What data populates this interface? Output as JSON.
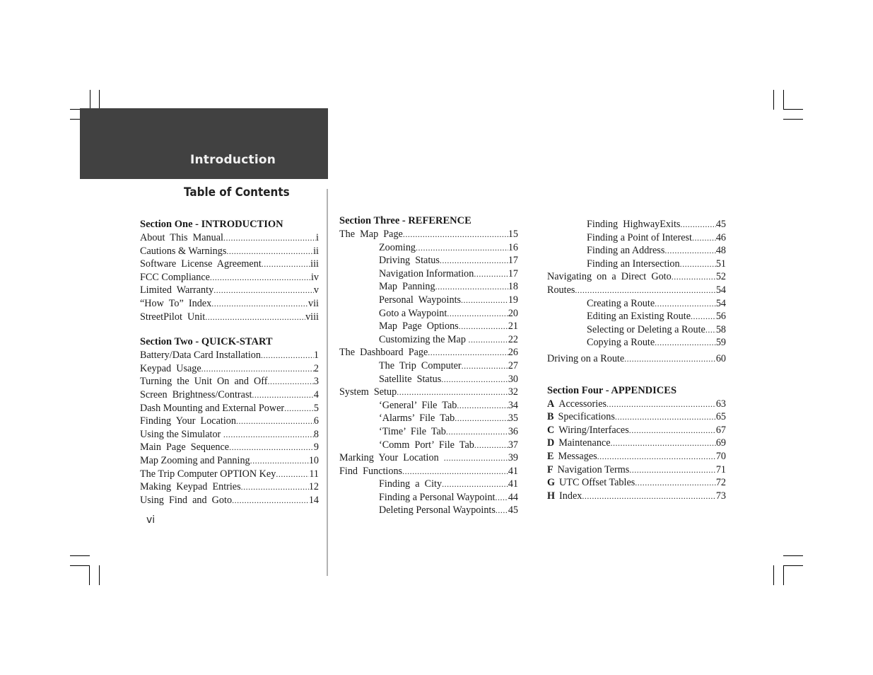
{
  "banner": {
    "title": "Introduction"
  },
  "toc_heading": "Table of Contents",
  "page_number": "vi",
  "columns": {
    "one": {
      "section_one": {
        "title": "Section One - INTRODUCTION",
        "entries": [
          {
            "label": "About  This  Manual",
            "page": "i"
          },
          {
            "label": "Cautions & Warnings",
            "page": "ii"
          },
          {
            "label": "Software  License  Agreement",
            "page": "iii"
          },
          {
            "label": "FCC Compliance",
            "page": "iv"
          },
          {
            "label": "Limited  Warranty",
            "page": "v"
          },
          {
            "label": "“How  To”  Index",
            "page": "vii"
          },
          {
            "label": "StreetPilot  Unit",
            "page": "viii"
          }
        ]
      },
      "section_two": {
        "title": "Section Two - QUICK-START",
        "entries": [
          {
            "label": "Battery/Data Card Installation",
            "page": "1"
          },
          {
            "label": "Keypad  Usage",
            "page": "2"
          },
          {
            "label": "Turning  the  Unit  On  and  Off",
            "page": "3"
          },
          {
            "label": "Screen  Brightness/Contrast",
            "page": "4"
          },
          {
            "label": "Dash Mounting and External Power",
            "page": "5"
          },
          {
            "label": "Finding  Your  Location",
            "page": "6"
          },
          {
            "label": "Using the Simulator ",
            "page": "8"
          },
          {
            "label": "Main  Page  Sequence",
            "page": "9"
          },
          {
            "label": "Map Zooming and Panning",
            "page": "10"
          },
          {
            "label": "The Trip Computer OPTION Key",
            "page": "11"
          },
          {
            "label": "Making  Keypad  Entries",
            "page": "12"
          },
          {
            "label": "Using  Find  and  Goto",
            "page": "14"
          }
        ]
      }
    },
    "two": {
      "section_three": {
        "title": "Section Three - REFERENCE",
        "entries": [
          {
            "label": "The  Map  Page",
            "page": "15",
            "indent": false
          },
          {
            "label": "Zooming",
            "page": "16",
            "indent": true
          },
          {
            "label": "Driving  Status",
            "page": "17",
            "indent": true
          },
          {
            "label": "Navigation Information",
            "page": "17",
            "indent": true
          },
          {
            "label": "Map  Panning",
            "page": "18",
            "indent": true
          },
          {
            "label": "Personal  Waypoints",
            "page": "19",
            "indent": true
          },
          {
            "label": "Goto a Waypoint",
            "page": "20",
            "indent": true
          },
          {
            "label": "Map  Page  Options",
            "page": "21",
            "indent": true
          },
          {
            "label": "Customizing the Map ",
            "page": "22",
            "indent": true
          },
          {
            "label": "The  Dashboard  Page",
            "page": "26",
            "indent": false
          },
          {
            "label": "The  Trip  Computer",
            "page": "27",
            "indent": true
          },
          {
            "label": "Satellite  Status",
            "page": "30",
            "indent": true
          },
          {
            "label": "System  Setup",
            "page": "32",
            "indent": false
          },
          {
            "label": "‘General’  File  Tab",
            "page": "34",
            "indent": true
          },
          {
            "label": "‘Alarms’  File  Tab",
            "page": "35",
            "indent": true
          },
          {
            "label": "‘Time’  File  Tab",
            "page": "36",
            "indent": true
          },
          {
            "label": "‘Comm  Port’  File  Tab",
            "page": "37",
            "indent": true
          },
          {
            "label": "Marking  Your  Location  ",
            "page": "39",
            "indent": false
          },
          {
            "label": "Find  Functions",
            "page": "41",
            "indent": false
          },
          {
            "label": "Finding  a  City",
            "page": "41",
            "indent": true
          },
          {
            "label": "Finding a Personal Waypoint",
            "page": "44",
            "indent": true
          },
          {
            "label": "Deleting Personal Waypoints",
            "page": "45",
            "indent": true
          }
        ]
      }
    },
    "three": {
      "continued": [
        {
          "label": "Finding  HighwayExits",
          "page": "45",
          "indent": true
        },
        {
          "label": "Finding a Point of Interest",
          "page": "46",
          "indent": true
        },
        {
          "label": "Finding an Address",
          "page": "48",
          "indent": true
        },
        {
          "label": "Finding an Intersection",
          "page": "51",
          "indent": true
        },
        {
          "label": "Navigating  on  a  Direct  Goto",
          "page": "52",
          "indent": false
        },
        {
          "label": "Routes",
          "page": "54",
          "indent": false
        },
        {
          "label": "Creating a Route",
          "page": "54",
          "indent": true
        },
        {
          "label": "Editing an Existing Route",
          "page": "56",
          "indent": true
        },
        {
          "label": "Selecting or Deleting a Route",
          "page": "58",
          "indent": true
        },
        {
          "label": "Copying a Route",
          "page": "59",
          "indent": true
        },
        {
          "label": "Driving on a Route",
          "page": "60",
          "indent": false
        }
      ],
      "section_four": {
        "title": "Section Four - APPENDICES",
        "entries": [
          {
            "letter": "A",
            "label": "Accessories",
            "page": "63"
          },
          {
            "letter": "B",
            "label": "Specifications",
            "page": "65"
          },
          {
            "letter": "C",
            "label": "Wiring/Interfaces",
            "page": "67"
          },
          {
            "letter": "D",
            "label": "Maintenance",
            "page": "69"
          },
          {
            "letter": "E",
            "label": "Messages",
            "page": "70"
          },
          {
            "letter": "F",
            "label": "Navigation Terms",
            "page": "71"
          },
          {
            "letter": "G",
            "label": "UTC Offset Tables",
            "page": "72"
          },
          {
            "letter": "H",
            "label": "Index",
            "page": "73"
          }
        ]
      }
    }
  }
}
